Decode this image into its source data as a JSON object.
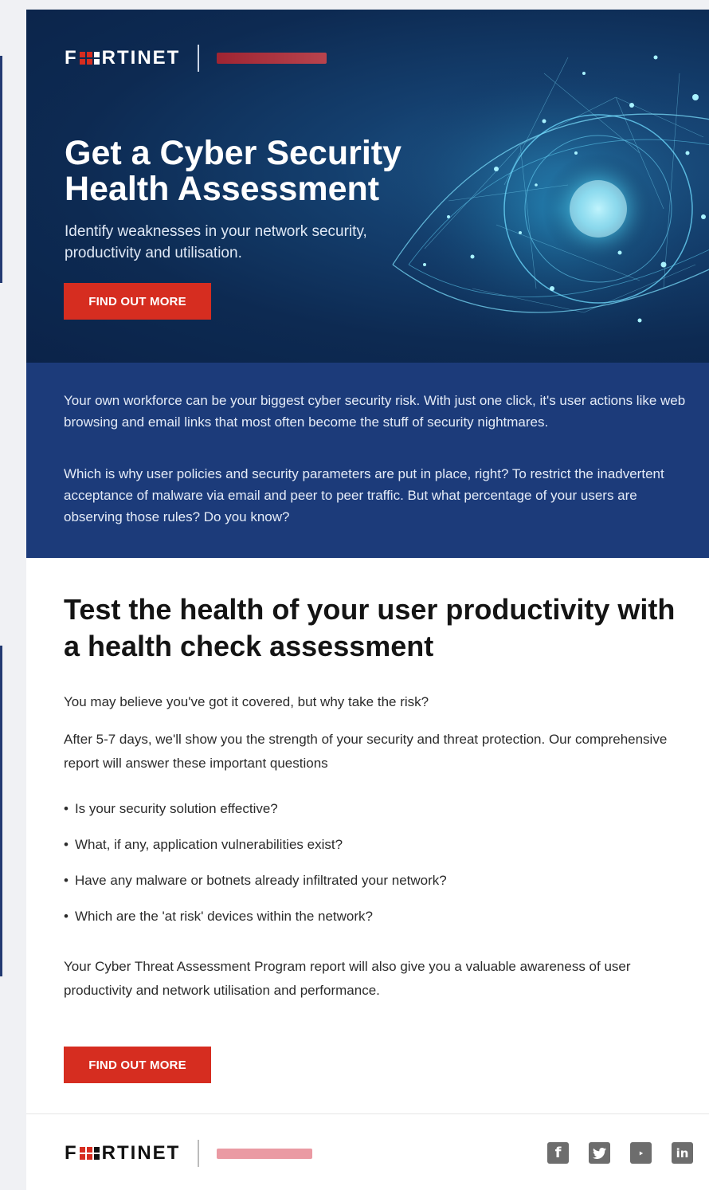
{
  "brand": {
    "logo_text_left": "F",
    "logo_text_right": "RTINET",
    "colors": {
      "brand_red": "#d62d20",
      "hero_bg": "#0d2a52",
      "intro_bg": "#1c3b7a",
      "body_text": "#2b2b2b"
    }
  },
  "hero": {
    "title": "Get a Cyber Security Health Assessment",
    "subtitle": "Identify weaknesses in your network security, productivity and utilisation.",
    "cta_label": "FIND OUT MORE",
    "image_icon": "cyber-eye-illustration"
  },
  "intro": {
    "paragraph_1": "Your own workforce can be your biggest cyber security risk.  With just one click, it's user actions like web browsing and email links that most often become the stuff of security nightmares.",
    "paragraph_2": "Which is why user policies and security parameters are put in place, right? To restrict the inadvertent acceptance of malware via email and peer to peer traffic. But what percentage of your users are observing those rules? Do you know?"
  },
  "content": {
    "title": "Test the health of your user productivity with a health check assessment",
    "paragraph_1": "You may believe you've got it covered, but why take the risk?",
    "paragraph_2": "After 5-7 days, we'll show you the strength of your security and threat protection. Our comprehensive report will answer these important questions",
    "questions": [
      "Is your security solution effective?",
      "What, if any, application vulnerabilities exist?",
      "Have any malware or botnets already infiltrated your network?",
      "Which are the 'at risk' devices within the network?"
    ],
    "paragraph_3": "Your Cyber Threat Assessment Program report will also give you a valuable awareness of user productivity and network utilisation and performance.",
    "cta_label": "FIND OUT MORE"
  },
  "footer": {
    "social_icons": [
      "facebook-icon",
      "twitter-icon",
      "youtube-icon",
      "linkedin-icon"
    ]
  }
}
